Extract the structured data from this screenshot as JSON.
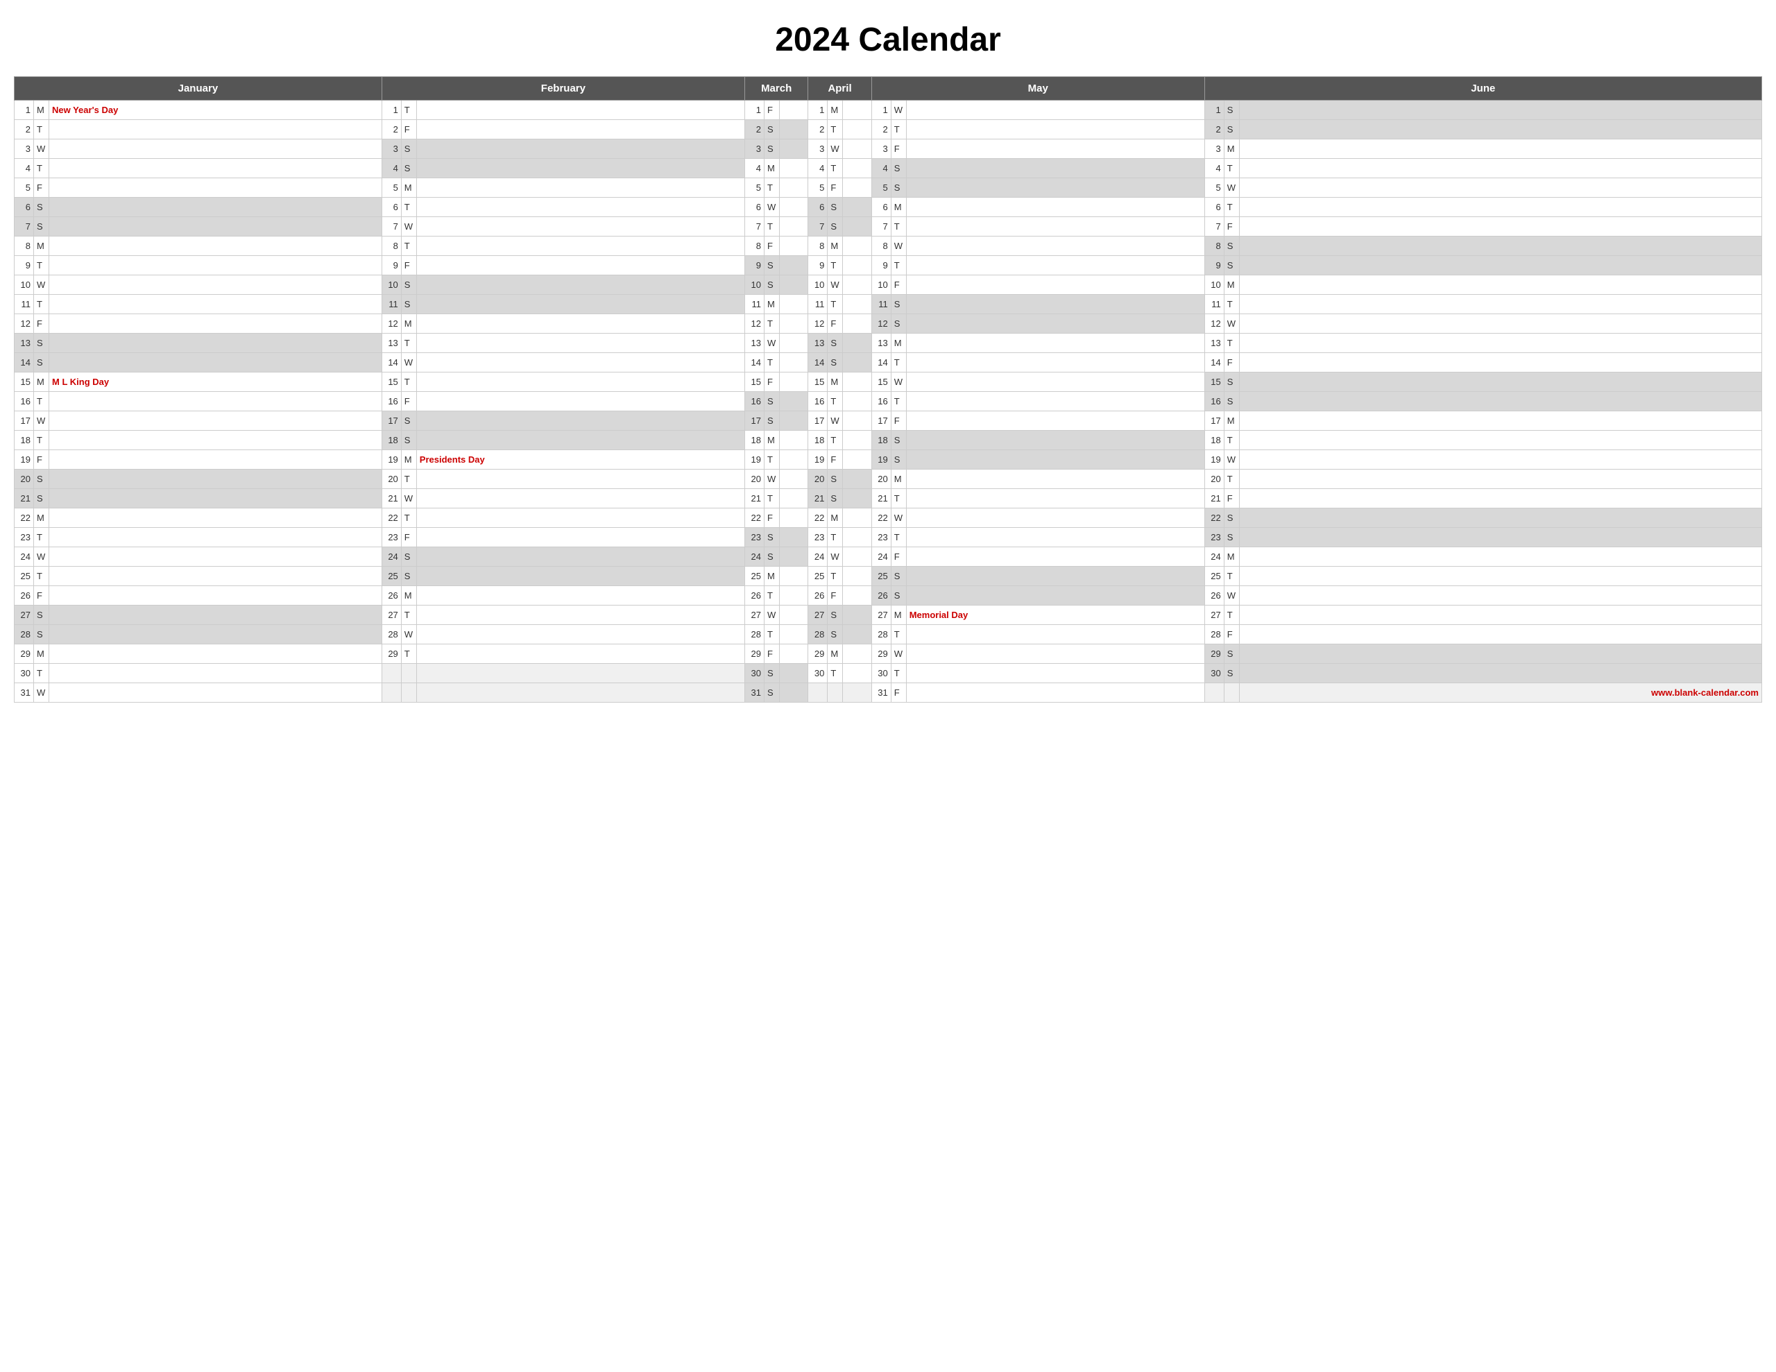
{
  "title": "2024 Calendar",
  "website": "www.blank-calendar.com",
  "months": {
    "january": "January",
    "february": "February",
    "march": "March",
    "april": "April",
    "may": "May",
    "june": "June"
  },
  "holidays": {
    "jan1": "New Year's Day",
    "jan15": "M L King Day",
    "feb19": "Presidents Day",
    "may27": "Memorial Day"
  },
  "days": {
    "jan": [
      {
        "d": 1,
        "w": "M",
        "h": "jan1"
      },
      {
        "d": 2,
        "w": "T"
      },
      {
        "d": 3,
        "w": "W"
      },
      {
        "d": 4,
        "w": "T"
      },
      {
        "d": 5,
        "w": "F"
      },
      {
        "d": 6,
        "w": "S",
        "wk": true
      },
      {
        "d": 7,
        "w": "S",
        "wk": true
      },
      {
        "d": 8,
        "w": "M"
      },
      {
        "d": 9,
        "w": "T"
      },
      {
        "d": 10,
        "w": "W"
      },
      {
        "d": 11,
        "w": "T"
      },
      {
        "d": 12,
        "w": "F"
      },
      {
        "d": 13,
        "w": "S",
        "wk": true
      },
      {
        "d": 14,
        "w": "S",
        "wk": true
      },
      {
        "d": 15,
        "w": "M",
        "h": "jan15"
      },
      {
        "d": 16,
        "w": "T"
      },
      {
        "d": 17,
        "w": "W"
      },
      {
        "d": 18,
        "w": "T"
      },
      {
        "d": 19,
        "w": "F"
      },
      {
        "d": 20,
        "w": "S",
        "wk": true
      },
      {
        "d": 21,
        "w": "S",
        "wk": true
      },
      {
        "d": 22,
        "w": "M"
      },
      {
        "d": 23,
        "w": "T"
      },
      {
        "d": 24,
        "w": "W"
      },
      {
        "d": 25,
        "w": "T"
      },
      {
        "d": 26,
        "w": "F"
      },
      {
        "d": 27,
        "w": "S",
        "wk": true
      },
      {
        "d": 28,
        "w": "S",
        "wk": true
      },
      {
        "d": 29,
        "w": "M"
      },
      {
        "d": 30,
        "w": "T"
      },
      {
        "d": 31,
        "w": "W"
      }
    ],
    "feb": [
      {
        "d": 1,
        "w": "T"
      },
      {
        "d": 2,
        "w": "F"
      },
      {
        "d": 3,
        "w": "S",
        "wk": true
      },
      {
        "d": 4,
        "w": "S",
        "wk": true
      },
      {
        "d": 5,
        "w": "M"
      },
      {
        "d": 6,
        "w": "T"
      },
      {
        "d": 7,
        "w": "W"
      },
      {
        "d": 8,
        "w": "T"
      },
      {
        "d": 9,
        "w": "F"
      },
      {
        "d": 10,
        "w": "S",
        "wk": true
      },
      {
        "d": 11,
        "w": "S",
        "wk": true
      },
      {
        "d": 12,
        "w": "M"
      },
      {
        "d": 13,
        "w": "T"
      },
      {
        "d": 14,
        "w": "W"
      },
      {
        "d": 15,
        "w": "T"
      },
      {
        "d": 16,
        "w": "F"
      },
      {
        "d": 17,
        "w": "S",
        "wk": true
      },
      {
        "d": 18,
        "w": "S",
        "wk": true
      },
      {
        "d": 19,
        "w": "M",
        "h": "feb19"
      },
      {
        "d": 20,
        "w": "T"
      },
      {
        "d": 21,
        "w": "W"
      },
      {
        "d": 22,
        "w": "T"
      },
      {
        "d": 23,
        "w": "F"
      },
      {
        "d": 24,
        "w": "S",
        "wk": true
      },
      {
        "d": 25,
        "w": "S",
        "wk": true
      },
      {
        "d": 26,
        "w": "M"
      },
      {
        "d": 27,
        "w": "T"
      },
      {
        "d": 28,
        "w": "W"
      },
      {
        "d": 29,
        "w": "T"
      },
      null,
      null
    ],
    "mar": [
      {
        "d": 1,
        "w": "F"
      },
      {
        "d": 2,
        "w": "S",
        "wk": true
      },
      {
        "d": 3,
        "w": "S",
        "wk": true
      },
      {
        "d": 4,
        "w": "M"
      },
      {
        "d": 5,
        "w": "T"
      },
      {
        "d": 6,
        "w": "W"
      },
      {
        "d": 7,
        "w": "T"
      },
      {
        "d": 8,
        "w": "F"
      },
      {
        "d": 9,
        "w": "S",
        "wk": true
      },
      {
        "d": 10,
        "w": "S",
        "wk": true
      },
      {
        "d": 11,
        "w": "M"
      },
      {
        "d": 12,
        "w": "T"
      },
      {
        "d": 13,
        "w": "W"
      },
      {
        "d": 14,
        "w": "T"
      },
      {
        "d": 15,
        "w": "F"
      },
      {
        "d": 16,
        "w": "S",
        "wk": true
      },
      {
        "d": 17,
        "w": "S",
        "wk": true
      },
      {
        "d": 18,
        "w": "M"
      },
      {
        "d": 19,
        "w": "T"
      },
      {
        "d": 20,
        "w": "W"
      },
      {
        "d": 21,
        "w": "T"
      },
      {
        "d": 22,
        "w": "F"
      },
      {
        "d": 23,
        "w": "S",
        "wk": true
      },
      {
        "d": 24,
        "w": "S",
        "wk": true
      },
      {
        "d": 25,
        "w": "M"
      },
      {
        "d": 26,
        "w": "T"
      },
      {
        "d": 27,
        "w": "W"
      },
      {
        "d": 28,
        "w": "T"
      },
      {
        "d": 29,
        "w": "F"
      },
      {
        "d": 30,
        "w": "S",
        "wk": true
      },
      {
        "d": 31,
        "w": "S",
        "wk": true
      }
    ],
    "apr": [
      {
        "d": 1,
        "w": "M"
      },
      {
        "d": 2,
        "w": "T"
      },
      {
        "d": 3,
        "w": "W"
      },
      {
        "d": 4,
        "w": "T"
      },
      {
        "d": 5,
        "w": "F"
      },
      {
        "d": 6,
        "w": "S",
        "wk": true
      },
      {
        "d": 7,
        "w": "S",
        "wk": true
      },
      {
        "d": 8,
        "w": "M"
      },
      {
        "d": 9,
        "w": "T"
      },
      {
        "d": 10,
        "w": "W"
      },
      {
        "d": 11,
        "w": "T"
      },
      {
        "d": 12,
        "w": "F"
      },
      {
        "d": 13,
        "w": "S",
        "wk": true
      },
      {
        "d": 14,
        "w": "S",
        "wk": true
      },
      {
        "d": 15,
        "w": "M"
      },
      {
        "d": 16,
        "w": "T"
      },
      {
        "d": 17,
        "w": "W"
      },
      {
        "d": 18,
        "w": "T"
      },
      {
        "d": 19,
        "w": "F"
      },
      {
        "d": 20,
        "w": "S",
        "wk": true
      },
      {
        "d": 21,
        "w": "S",
        "wk": true
      },
      {
        "d": 22,
        "w": "M"
      },
      {
        "d": 23,
        "w": "T"
      },
      {
        "d": 24,
        "w": "W"
      },
      {
        "d": 25,
        "w": "T"
      },
      {
        "d": 26,
        "w": "F"
      },
      {
        "d": 27,
        "w": "S",
        "wk": true
      },
      {
        "d": 28,
        "w": "S",
        "wk": true
      },
      {
        "d": 29,
        "w": "M"
      },
      {
        "d": 30,
        "w": "T"
      },
      null
    ],
    "may": [
      {
        "d": 1,
        "w": "W"
      },
      {
        "d": 2,
        "w": "T"
      },
      {
        "d": 3,
        "w": "F"
      },
      {
        "d": 4,
        "w": "S",
        "wk": true
      },
      {
        "d": 5,
        "w": "S",
        "wk": true
      },
      {
        "d": 6,
        "w": "M"
      },
      {
        "d": 7,
        "w": "T"
      },
      {
        "d": 8,
        "w": "W"
      },
      {
        "d": 9,
        "w": "T"
      },
      {
        "d": 10,
        "w": "F"
      },
      {
        "d": 11,
        "w": "S",
        "wk": true
      },
      {
        "d": 12,
        "w": "S",
        "wk": true
      },
      {
        "d": 13,
        "w": "M"
      },
      {
        "d": 14,
        "w": "T"
      },
      {
        "d": 15,
        "w": "W"
      },
      {
        "d": 16,
        "w": "T"
      },
      {
        "d": 17,
        "w": "F"
      },
      {
        "d": 18,
        "w": "S",
        "wk": true
      },
      {
        "d": 19,
        "w": "S",
        "wk": true
      },
      {
        "d": 20,
        "w": "M"
      },
      {
        "d": 21,
        "w": "T"
      },
      {
        "d": 22,
        "w": "W"
      },
      {
        "d": 23,
        "w": "T"
      },
      {
        "d": 24,
        "w": "F"
      },
      {
        "d": 25,
        "w": "S",
        "wk": true
      },
      {
        "d": 26,
        "w": "S",
        "wk": true
      },
      {
        "d": 27,
        "w": "M",
        "h": "may27"
      },
      {
        "d": 28,
        "w": "T"
      },
      {
        "d": 29,
        "w": "W"
      },
      {
        "d": 30,
        "w": "T"
      },
      {
        "d": 31,
        "w": "F"
      }
    ],
    "jun": [
      {
        "d": 1,
        "w": "S",
        "wk": true
      },
      {
        "d": 2,
        "w": "S",
        "wk": true
      },
      {
        "d": 3,
        "w": "M"
      },
      {
        "d": 4,
        "w": "T"
      },
      {
        "d": 5,
        "w": "W"
      },
      {
        "d": 6,
        "w": "T"
      },
      {
        "d": 7,
        "w": "F"
      },
      {
        "d": 8,
        "w": "S",
        "wk": true
      },
      {
        "d": 9,
        "w": "S",
        "wk": true
      },
      {
        "d": 10,
        "w": "M"
      },
      {
        "d": 11,
        "w": "T"
      },
      {
        "d": 12,
        "w": "W"
      },
      {
        "d": 13,
        "w": "T"
      },
      {
        "d": 14,
        "w": "F"
      },
      {
        "d": 15,
        "w": "S",
        "wk": true
      },
      {
        "d": 16,
        "w": "S",
        "wk": true
      },
      {
        "d": 17,
        "w": "M"
      },
      {
        "d": 18,
        "w": "T"
      },
      {
        "d": 19,
        "w": "W"
      },
      {
        "d": 20,
        "w": "T"
      },
      {
        "d": 21,
        "w": "F"
      },
      {
        "d": 22,
        "w": "S",
        "wk": true
      },
      {
        "d": 23,
        "w": "S",
        "wk": true
      },
      {
        "d": 24,
        "w": "M"
      },
      {
        "d": 25,
        "w": "T"
      },
      {
        "d": 26,
        "w": "W"
      },
      {
        "d": 27,
        "w": "T"
      },
      {
        "d": 28,
        "w": "F"
      },
      {
        "d": 29,
        "w": "S",
        "wk": true
      },
      {
        "d": 30,
        "w": "S",
        "wk": true
      },
      null
    ]
  }
}
